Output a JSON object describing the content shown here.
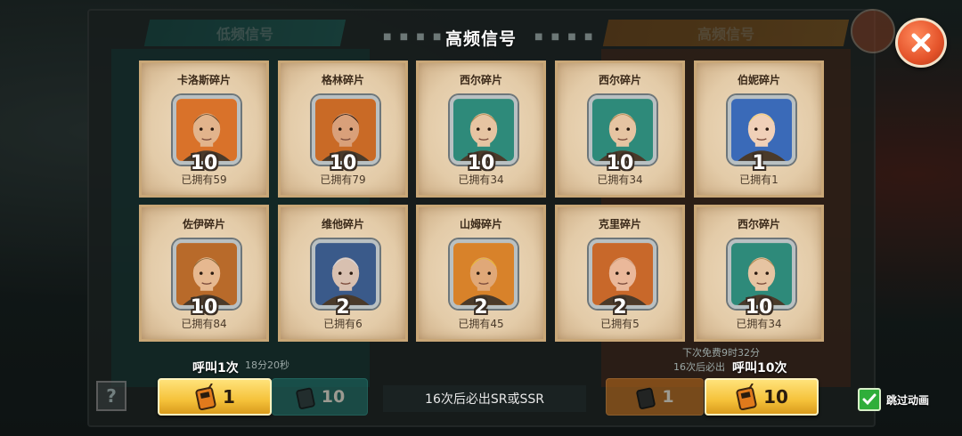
{
  "header": {
    "title": "高频信号",
    "tab_left": "低频信号",
    "tab_right": "高频信号"
  },
  "cards": [
    {
      "name": "卡洛斯碎片",
      "count": "10",
      "owned": "已拥有59",
      "icon": "hero-carlos-portrait",
      "bg": "#d9722a",
      "skin": "#e2b48c",
      "hair": "#6a4a2c"
    },
    {
      "name": "格林碎片",
      "count": "10",
      "owned": "已拥有79",
      "icon": "hero-green-portrait",
      "bg": "#c96a26",
      "skin": "#d9a07a",
      "hair": "#2b1a12"
    },
    {
      "name": "西尔碎片",
      "count": "10",
      "owned": "已拥有34",
      "icon": "hero-seal-portrait",
      "bg": "#2e8a7a",
      "skin": "#e6c4a2",
      "hair": "#b08a52"
    },
    {
      "name": "西尔碎片",
      "count": "10",
      "owned": "已拥有34",
      "icon": "hero-seal-portrait",
      "bg": "#2e8a7a",
      "skin": "#e6c4a2",
      "hair": "#b08a52"
    },
    {
      "name": "伯妮碎片",
      "count": "1",
      "owned": "已拥有1",
      "icon": "hero-bonnie-portrait",
      "bg": "#3a6ab8",
      "skin": "#f0d0b8",
      "hair": "#f0d070"
    },
    {
      "name": "佐伊碎片",
      "count": "10",
      "owned": "已拥有84",
      "icon": "hero-zoe-portrait",
      "bg": "#b86a2a",
      "skin": "#e6b890",
      "hair": "#8a6a3a"
    },
    {
      "name": "维他碎片",
      "count": "2",
      "owned": "已拥有6",
      "icon": "hero-vita-portrait",
      "bg": "#3a5a8a",
      "skin": "#d8c0b0",
      "hair": "#d8d8dc"
    },
    {
      "name": "山姆碎片",
      "count": "2",
      "owned": "已拥有45",
      "icon": "hero-sam-portrait",
      "bg": "#d8822a",
      "skin": "#e0a878",
      "hair": "#e8b830"
    },
    {
      "name": "克里碎片",
      "count": "2",
      "owned": "已拥有5",
      "icon": "hero-kerry-portrait",
      "bg": "#c8682a",
      "skin": "#eab89a",
      "hair": "#d0a080"
    },
    {
      "name": "西尔碎片",
      "count": "10",
      "owned": "已拥有34",
      "icon": "hero-seal-portrait",
      "bg": "#2e8a7a",
      "skin": "#e6c4a2",
      "hair": "#b08a52"
    }
  ],
  "controls": {
    "call_1_label": "呼叫1次",
    "call_1_cost": "1",
    "call_10_label": "呼叫10次",
    "call_10_cost": "10",
    "left_dim_cost_1": "1",
    "left_dim_cost_10": "10",
    "right_dim_cost_1": "1",
    "guarantee": "16次后必出SR或SSR",
    "skip_label": "跳过动画",
    "skip_checked": true,
    "next_free": "下次免费9时32分",
    "right_guarantee_partial": "16次后必出",
    "left_timer_partial": "18分20秒"
  },
  "colors": {
    "accent_gold": "#f5c23a",
    "close_orange": "#e4532a",
    "card_parchment": "#e3cba8"
  }
}
